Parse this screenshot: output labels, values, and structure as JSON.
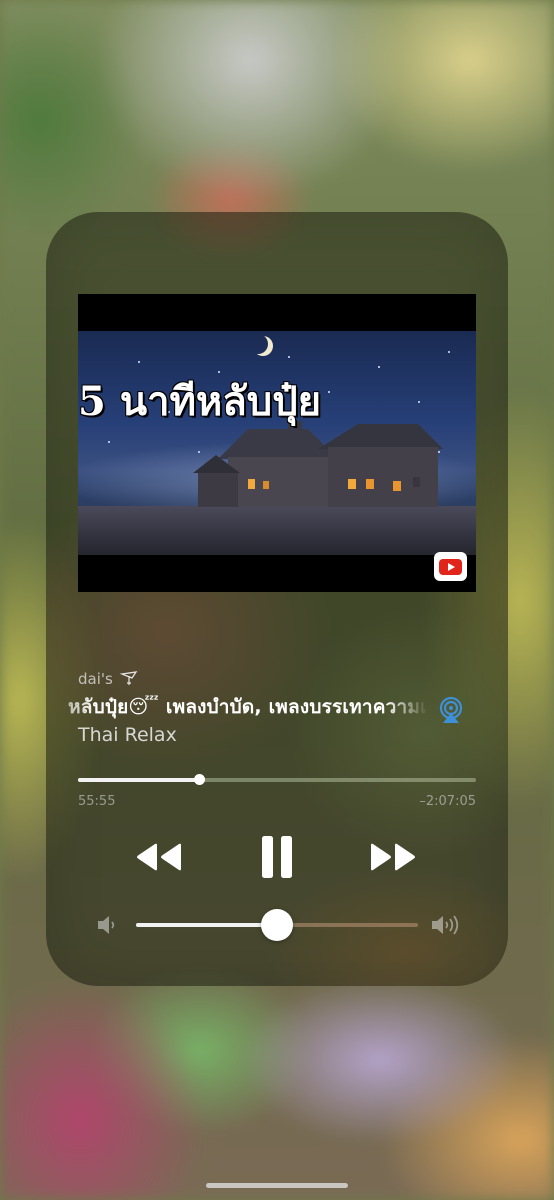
{
  "now_playing": {
    "artwork": {
      "overlay_text": "5 นาทีหลับปุ๋ย",
      "badge_icon": "youtube-logo-icon"
    },
    "source_app": "dai's",
    "source_icon": "pen-nib-icon",
    "title": "หลับปุ๋ย😴 เพลงบำบัด, เพลงบรรเทาความเครียด",
    "artist": "Thai Relax",
    "progress": {
      "elapsed": "55:55",
      "remaining": "–2:07:05",
      "fraction": 0.305
    },
    "controls": {
      "rewind_icon": "rewind-icon",
      "pause_icon": "pause-icon",
      "forward_icon": "fast-forward-icon",
      "airplay_icon": "airplay-icon"
    },
    "volume": {
      "level": 0.5,
      "low_icon": "speaker-low-icon",
      "high_icon": "speaker-high-icon"
    }
  },
  "colors": {
    "card_background": "#262a18",
    "youtube_red": "#e1251b",
    "airplay_blue": "#3d8fd6"
  }
}
